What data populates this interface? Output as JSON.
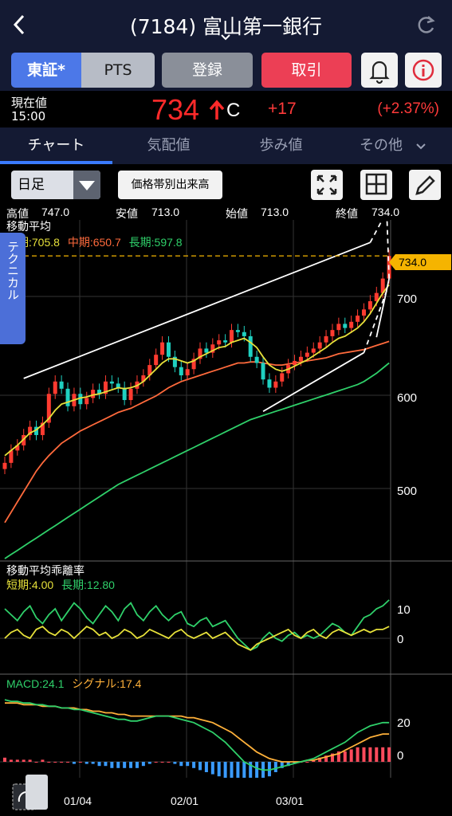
{
  "header": {
    "title": "(7184) 富山第一銀行"
  },
  "buttons": {
    "tse": "東証*",
    "pts": "PTS",
    "register": "登録",
    "trade": "取引"
  },
  "price": {
    "label": "現在値",
    "time": "15:00",
    "value": "734",
    "marker": "C",
    "change": "+17",
    "change_pct": "(+2.37%)"
  },
  "tabs": [
    {
      "label": "チャート",
      "active": true
    },
    {
      "label": "気配値",
      "active": false
    },
    {
      "label": "歩み値",
      "active": false
    },
    {
      "label": "その他",
      "active": false
    }
  ],
  "toolbar": {
    "period": "日足",
    "volume_button": "価格帯別出来高"
  },
  "ohlc": {
    "high_label": "高値",
    "high": "747.0",
    "low_label": "安値",
    "low": "713.0",
    "open_label": "始値",
    "open": "713.0",
    "close_label": "終値",
    "close": "734.0"
  },
  "side_tab": "テクニカル",
  "colors": {
    "up": "#ff3b30",
    "down": "#1fd1c1",
    "ma_short": "#e6e03a",
    "ma_mid": "#ff6a3c",
    "ma_long": "#2fd06a",
    "macd": "#2fd06a",
    "signal": "#ffb13a"
  },
  "chart_data": [
    {
      "type": "line",
      "title": "移動平均",
      "legend": [
        {
          "name": "短期",
          "value": "705.8",
          "color": "#e6e03a"
        },
        {
          "name": "中期",
          "value": "650.7",
          "color": "#ff6a3c"
        },
        {
          "name": "長期",
          "value": "597.8",
          "color": "#2fd06a"
        }
      ],
      "current_price_label": "734.0",
      "current_price": 734,
      "ylim": [
        440,
        755
      ],
      "y_ticks": [
        "700",
        "600",
        "500"
      ],
      "x_ticks": [
        "01/04",
        "02/01",
        "03/01"
      ],
      "close_series": [
        533,
        545,
        550,
        560,
        568,
        560,
        572,
        600,
        612,
        605,
        588,
        600,
        590,
        596,
        604,
        600,
        612,
        610,
        606,
        594,
        605,
        612,
        618,
        628,
        638,
        650,
        636,
        626,
        618,
        624,
        634,
        644,
        640,
        648,
        652,
        650,
        662,
        660,
        656,
        636,
        630,
        614,
        606,
        612,
        620,
        628,
        632,
        636,
        640,
        644,
        650,
        656,
        662,
        668,
        664,
        670,
        676,
        682,
        690,
        698,
        712,
        734
      ],
      "ma_short": [
        540,
        545,
        550,
        556,
        562,
        565,
        570,
        576,
        584,
        590,
        592,
        594,
        596,
        597,
        599,
        600,
        602,
        604,
        606,
        605,
        606,
        608,
        612,
        618,
        624,
        630,
        634,
        634,
        632,
        630,
        632,
        636,
        639,
        642,
        645,
        646,
        650,
        652,
        654,
        650,
        645,
        636,
        628,
        624,
        622,
        624,
        627,
        630,
        633,
        637,
        641,
        645,
        650,
        654,
        656,
        660,
        664,
        670,
        678,
        688,
        698,
        706
      ],
      "ma_mid": [
        475,
        485,
        495,
        505,
        515,
        525,
        533,
        540,
        546,
        552,
        556,
        560,
        564,
        567,
        570,
        573,
        576,
        579,
        582,
        584,
        586,
        589,
        592,
        595,
        598,
        602,
        606,
        609,
        612,
        614,
        616,
        618,
        620,
        622,
        624,
        626,
        628,
        630,
        630,
        631,
        631,
        630,
        629,
        628,
        628,
        629,
        630,
        631,
        632,
        633,
        634,
        635,
        637,
        639,
        640,
        641,
        642,
        643,
        645,
        647,
        649,
        651
      ],
      "ma_long": [
        440,
        444,
        448,
        452,
        456,
        460,
        464,
        468,
        472,
        476,
        480,
        484,
        488,
        492,
        496,
        500,
        504,
        508,
        512,
        515,
        518,
        521,
        524,
        527,
        530,
        533,
        536,
        539,
        542,
        545,
        548,
        551,
        554,
        557,
        560,
        563,
        566,
        569,
        572,
        575,
        577,
        579,
        581,
        583,
        585,
        587,
        589,
        591,
        593,
        595,
        597,
        599,
        601,
        603,
        605,
        607,
        609,
        612,
        616,
        620,
        625,
        630
      ]
    },
    {
      "type": "line",
      "title": "移動平均乖離率",
      "series": [
        {
          "name": "短期",
          "value": "4.00",
          "color": "#e6e03a",
          "values": [
            0,
            2,
            3,
            1,
            0,
            3,
            4,
            2,
            1,
            3,
            2,
            0,
            2,
            4,
            3,
            1,
            2,
            0,
            1,
            3,
            2,
            0,
            1,
            3,
            2,
            1,
            0,
            2,
            3,
            1,
            0,
            1,
            2,
            0,
            1,
            2,
            0,
            -2,
            -3,
            -4,
            -2,
            -1,
            0,
            1,
            2,
            3,
            1,
            0,
            2,
            3,
            1,
            0,
            2,
            3,
            2,
            1,
            2,
            3,
            2,
            3,
            3,
            4
          ]
        },
        {
          "name": "長期",
          "value": "12.80",
          "color": "#2fd06a",
          "values": [
            10,
            8,
            6,
            9,
            11,
            7,
            5,
            8,
            10,
            6,
            9,
            12,
            10,
            7,
            5,
            8,
            11,
            9,
            6,
            10,
            12,
            8,
            6,
            9,
            11,
            8,
            6,
            8,
            9,
            5,
            4,
            6,
            7,
            4,
            5,
            6,
            3,
            0,
            -2,
            -4,
            -3,
            0,
            2,
            0,
            -1,
            1,
            2,
            0,
            1,
            0,
            1,
            3,
            5,
            4,
            2,
            1,
            4,
            7,
            8,
            10,
            11,
            13
          ]
        }
      ],
      "y_ticks": [
        "10",
        "0"
      ]
    },
    {
      "type": "line",
      "title": "MACD",
      "series": [
        {
          "name": "MACD",
          "value": "24.1",
          "color": "#2fd06a",
          "values": [
            38,
            37,
            37,
            36,
            36,
            35,
            35,
            34,
            34,
            33,
            33,
            32,
            32,
            31,
            30,
            29,
            28,
            27,
            26,
            26,
            25,
            25,
            26,
            27,
            28,
            28,
            28,
            27,
            26,
            25,
            24,
            22,
            20,
            18,
            15,
            12,
            8,
            4,
            0,
            -2,
            -4,
            -5,
            -5,
            -4,
            -3,
            -2,
            -1,
            0,
            1,
            2,
            4,
            6,
            8,
            10,
            12,
            15,
            18,
            20,
            22,
            23,
            24,
            24
          ]
        },
        {
          "name": "シグナル",
          "value": "17.4",
          "color": "#ffb13a",
          "values": [
            36,
            36,
            36,
            35,
            35,
            35,
            34,
            34,
            34,
            33,
            33,
            33,
            32,
            32,
            31,
            31,
            30,
            30,
            29,
            29,
            28,
            28,
            28,
            28,
            28,
            28,
            28,
            28,
            28,
            27,
            27,
            26,
            25,
            24,
            22,
            20,
            18,
            15,
            12,
            9,
            6,
            4,
            2,
            1,
            0,
            0,
            0,
            0,
            1,
            1,
            2,
            3,
            4,
            5,
            7,
            9,
            11,
            13,
            15,
            16,
            17,
            17
          ]
        },
        {
          "name": "histogram",
          "values": [
            2,
            1,
            1,
            1,
            1,
            0,
            1,
            0,
            0,
            0,
            0,
            -1,
            0,
            -1,
            -1,
            -2,
            -2,
            -3,
            -3,
            -3,
            -3,
            -3,
            -2,
            -1,
            0,
            0,
            0,
            -1,
            -2,
            -2,
            -3,
            -4,
            -5,
            -6,
            -7,
            -8,
            -10,
            -11,
            -12,
            -11,
            -10,
            -9,
            -7,
            -5,
            -3,
            -2,
            -1,
            0,
            0,
            1,
            2,
            3,
            4,
            5,
            5,
            6,
            7,
            7,
            7,
            7,
            7,
            7
          ]
        }
      ],
      "y_ticks": [
        "20",
        "0"
      ]
    }
  ]
}
